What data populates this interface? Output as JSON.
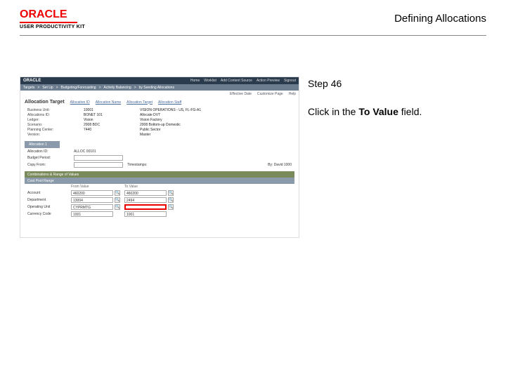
{
  "header": {
    "brand": "ORACLE",
    "subbrand": "USER PRODUCTIVITY KIT",
    "title": "Defining Allocations"
  },
  "instructions": {
    "step_label": "Step 46",
    "text_prefix": "Click in the ",
    "text_bold": "To Value",
    "text_suffix": " field."
  },
  "screenshot": {
    "logo": "ORACLE",
    "nav": [
      "Home",
      "Worklist",
      "Add Content Source",
      "Action Preview",
      "Signout"
    ],
    "breadcrumb": [
      "Targets",
      "Set Up",
      "Budgeting/Forecasting",
      "Activity Balancing",
      "by Seeding Allocations"
    ],
    "meta": {
      "effdate": "Effective Date",
      "custpage": "Customize Page",
      "help": "Help"
    },
    "page_title": "Allocation Target",
    "title_links": [
      "Allocation ID",
      "Allocation Name",
      "Allocation Target",
      "Allocation Staff"
    ],
    "details": [
      {
        "lbl": "Business Unit:",
        "v1": "10001",
        "v2": "VISION OPERATIONS - US, FL-FG-A1"
      },
      {
        "lbl": "Allocations ID:",
        "v1": "BONET 101",
        "v2": "Allocate DVT"
      },
      {
        "lbl": "Ledger:",
        "v1": "Vision",
        "v2": "Vision Factory"
      },
      {
        "lbl": "Scenario:",
        "v1": "2008 BDC",
        "v2": "2008 Bottom-up Domestic"
      },
      {
        "lbl": "Planning Center:",
        "v1": "7440",
        "v2": "Public Sector"
      },
      {
        "lbl": "Version:",
        "v1": "",
        "v2": "Master"
      }
    ],
    "tab": "Allocation 1",
    "form": {
      "alloc_row": {
        "lbl": "Allocation ID:",
        "val": "ALLOC 00101"
      },
      "budget_row": {
        "lbl": "Budget Period:",
        "val": ""
      },
      "copy_row": {
        "lbl": "Copy From:",
        "val": "",
        "status": "Timestamps:",
        "right": "By: David 1000"
      }
    },
    "bar1": "Combinations & Range of Values",
    "bar2": "Cost Pool Range",
    "table": {
      "headers": {
        "from": "From Value",
        "to": "To Value"
      },
      "rows": [
        {
          "lbl": "Account",
          "from": "460200",
          "to": "460200"
        },
        {
          "lbl": "Department",
          "from": "13004",
          "to": "2494"
        },
        {
          "lbl": "Operating Unit",
          "from": "CYPRMTG",
          "to": ""
        },
        {
          "lbl": "Currency Code",
          "from": "1001",
          "to": "1001"
        }
      ]
    }
  }
}
